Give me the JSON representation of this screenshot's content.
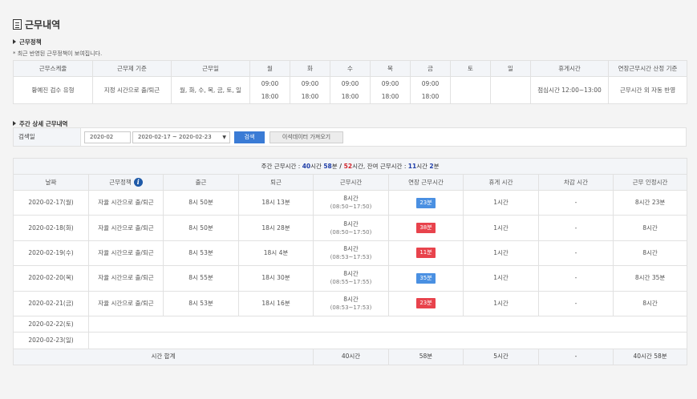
{
  "page": {
    "title": "근무내역",
    "note": "* 최근 반영된 근무정책이 보여집니다."
  },
  "policy": {
    "section_title": "근무정책",
    "headers": [
      "근무스케줄",
      "근무제 기준",
      "근무일",
      "월",
      "화",
      "수",
      "목",
      "금",
      "토",
      "일",
      "휴게시간",
      "연장근무시간 산정 기준"
    ],
    "row": {
      "schedule": "황예진 검수 유형",
      "basis": "지정 시간으로 출/퇴근",
      "workdays": "월, 화, 수, 목, 금, 토, 일",
      "mon": {
        "start": "09:00",
        "end": "18:00"
      },
      "tue": {
        "start": "09:00",
        "end": "18:00"
      },
      "wed": {
        "start": "09:00",
        "end": "18:00"
      },
      "thu": {
        "start": "09:00",
        "end": "18:00"
      },
      "fri": {
        "start": "09:00",
        "end": "18:00"
      },
      "sat": "",
      "sun": "",
      "break": "점심시간 12:00~13:00",
      "overtime_basis": "근무시간 외 자동 반영"
    }
  },
  "weekly": {
    "section_title": "주간 상세 근무내역",
    "search": {
      "label": "검색일",
      "month": "2020-02",
      "range": "2020-02-17 ~ 2020-02-23",
      "search_button": "검색",
      "import_button": "이석데이터 가져오기"
    },
    "summary": {
      "prefix": "주간 근무시간 : ",
      "worked_h": "40",
      "h_unit": "시간 ",
      "worked_m": "58",
      "m_unit": "분",
      "slash": " / ",
      "limit_h": "52",
      "limit_suffix": "시간, 잔여 근무시간 : ",
      "remain_h": "11",
      "remain_m": "2"
    },
    "headers": [
      "날짜",
      "근무정책",
      "출근",
      "퇴근",
      "근무시간",
      "연장 근무시간",
      "휴게 시간",
      "차감 시간",
      "근무 인정시간"
    ],
    "rows": [
      {
        "date": "2020-02-17(월)",
        "policy": "자율 시간으로 출/퇴근",
        "in": "8시 50분",
        "out": "18시 13분",
        "work": "8시간",
        "work_range": "(08:50~17:50)",
        "overtime": "23분",
        "overtime_color": "#4a90e2",
        "break": "1시간",
        "deduct": "-",
        "approved": "8시간 23분"
      },
      {
        "date": "2020-02-18(화)",
        "policy": "자율 시간으로 출/퇴근",
        "in": "8시 50분",
        "out": "18시 28분",
        "work": "8시간",
        "work_range": "(08:50~17:50)",
        "overtime": "38분",
        "overtime_color": "#e8434c",
        "break": "1시간",
        "deduct": "-",
        "approved": "8시간"
      },
      {
        "date": "2020-02-19(수)",
        "policy": "자율 시간으로 출/퇴근",
        "in": "8시 53분",
        "out": "18시 4분",
        "work": "8시간",
        "work_range": "(08:53~17:53)",
        "overtime": "11분",
        "overtime_color": "#e8434c",
        "break": "1시간",
        "deduct": "-",
        "approved": "8시간"
      },
      {
        "date": "2020-02-20(목)",
        "policy": "자율 시간으로 출/퇴근",
        "in": "8시 55분",
        "out": "18시 30분",
        "work": "8시간",
        "work_range": "(08:55~17:55)",
        "overtime": "35분",
        "overtime_color": "#4a90e2",
        "break": "1시간",
        "deduct": "-",
        "approved": "8시간 35분"
      },
      {
        "date": "2020-02-21(금)",
        "policy": "자율 시간으로 출/퇴근",
        "in": "8시 53분",
        "out": "18시 16분",
        "work": "8시간",
        "work_range": "(08:53~17:53)",
        "overtime": "23분",
        "overtime_color": "#e8434c",
        "break": "1시간",
        "deduct": "-",
        "approved": "8시간"
      }
    ],
    "empty_rows": [
      {
        "date": "2020-02-22(토)"
      },
      {
        "date": "2020-02-23(일)"
      }
    ],
    "total": {
      "label": "시간 합계",
      "work": "40시간",
      "overtime": "58분",
      "break": "5시간",
      "deduct": "-",
      "approved": "40시간 58분"
    }
  }
}
